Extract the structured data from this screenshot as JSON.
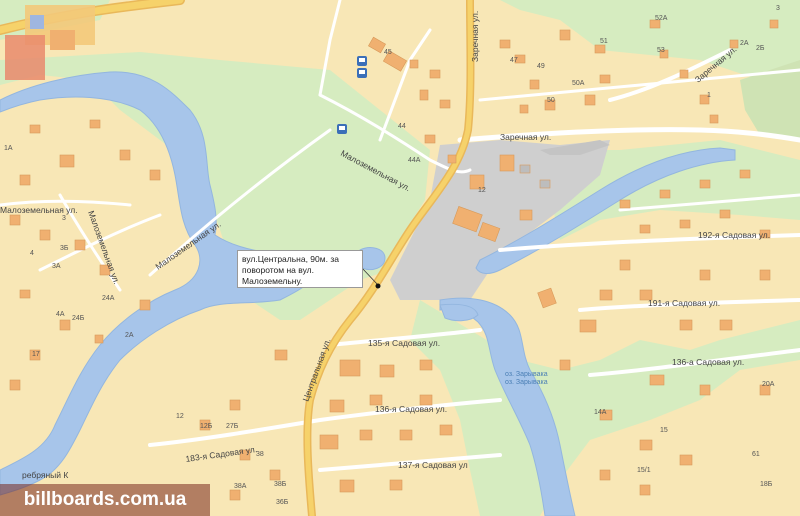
{
  "map": {
    "streets": {
      "zarechnaya_vertical": "Заречная ул.",
      "zarechnaya_horizontal": "Заречная ул.",
      "zarechnaya_right": "Заречная ул.",
      "malozemelnaya_center": "Малоземельная ул.",
      "malozemelnaya_west": "Малоземельная ул.",
      "malozemelnaya_left": "Малоземельная ул.",
      "malozemelnaya_vertical": "Малоземельная ул.",
      "centralnaya": "Центральная ул.",
      "sadovaya_135": "135-я Садовая ул.",
      "sadovaya_136": "136-я Садовая ул.",
      "sadovaya_136a": "136-а Садовая ул.",
      "sadovaya_137": "137-я Садовая ул",
      "sadovaya_183": "183-я Садовая ул.",
      "sadovaya_191": "191-я Садовая ул.",
      "sadovaya_192": "192-я Садовая ул.",
      "serebryany": "ребряный К"
    },
    "water_labels": {
      "lake1": "оз. Зарывака",
      "lake2": "оз. Зарывака"
    },
    "house_numbers": {
      "n52a": "52А",
      "n2a": "2А",
      "n2b": "2Б",
      "n53": "53",
      "n51": "51",
      "n47": "47",
      "n49": "49",
      "n50a": "50А",
      "n50": "50",
      "n1": "1",
      "n45": "45",
      "n44": "44",
      "n44a": "44А",
      "n12": "12",
      "n1a": "1А",
      "n3": "3",
      "n3b": "3Б",
      "n3a": "3А",
      "n4": "4",
      "n24a": "24А",
      "n24b": "24Б",
      "n2a_w": "2А",
      "n4a": "4А",
      "n17": "17",
      "n12b": "12Б",
      "n27b": "27Б",
      "n12_s": "12",
      "n38": "38",
      "n38b": "38Б",
      "n38a": "38А",
      "n36b": "36Б",
      "n14a": "14А",
      "n15": "15",
      "n15i": "15/1",
      "n20a": "20А",
      "n18b": "18Б",
      "n61": "61",
      "n3_e": "3"
    },
    "callout": {
      "line1": "вул.Центральна, 90м. за",
      "line2": "поворотом на вул. Малоземельну."
    },
    "watermark": "billboards.com.ua",
    "colors": {
      "background": "#f8e7b6",
      "water": "#a7c5ea",
      "park": "#d6ecc0",
      "building": "#f0b070",
      "road_main": "#f6d26a",
      "road": "#ffffff",
      "industrial": "#cfcfcf"
    }
  }
}
